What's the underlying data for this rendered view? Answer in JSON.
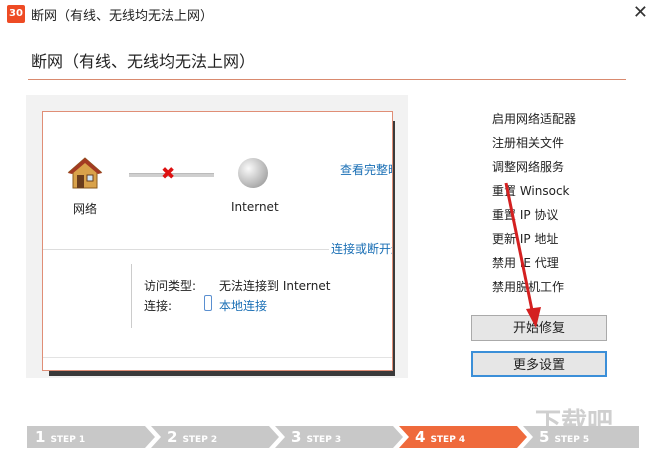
{
  "window": {
    "title": "断网（有线、无线均无法上网）",
    "app_icon_text": "30",
    "close_glyph": "✕"
  },
  "header": {
    "title": "断网（有线、无线均无法上网）"
  },
  "network": {
    "left_label": "网络",
    "right_label": "Internet",
    "view_link": "查看完整映射",
    "connect_link": "连接或断开连接",
    "access_type_label": "访问类型:",
    "access_type_value": "无法连接到 Internet",
    "connection_label": "连接:",
    "connection_value": "本地连接",
    "error_glyph": "✖"
  },
  "menu": [
    "启用网络适配器",
    "注册相关文件",
    "调整网络服务",
    "重置 Winsock",
    "重置 IP 协议",
    "更新 IP 地址",
    "禁用 IE 代理",
    "禁用脱机工作"
  ],
  "buttons": {
    "start": "开始修复",
    "more": "更多设置"
  },
  "steps": [
    {
      "num": "1",
      "label": "STEP 1",
      "color": "#c8c8c8"
    },
    {
      "num": "2",
      "label": "STEP 2",
      "color": "#c8c8c8"
    },
    {
      "num": "3",
      "label": "STEP 3",
      "color": "#c8c8c8"
    },
    {
      "num": "4",
      "label": "STEP 4",
      "color": "#ef6a3c"
    },
    {
      "num": "5",
      "label": "STEP 5",
      "color": "#c8c8c8"
    }
  ],
  "watermark": "下载吧",
  "colors": {
    "accent": "#ef6a3c",
    "link": "#1a6fb5",
    "arrow": "#d42020"
  }
}
